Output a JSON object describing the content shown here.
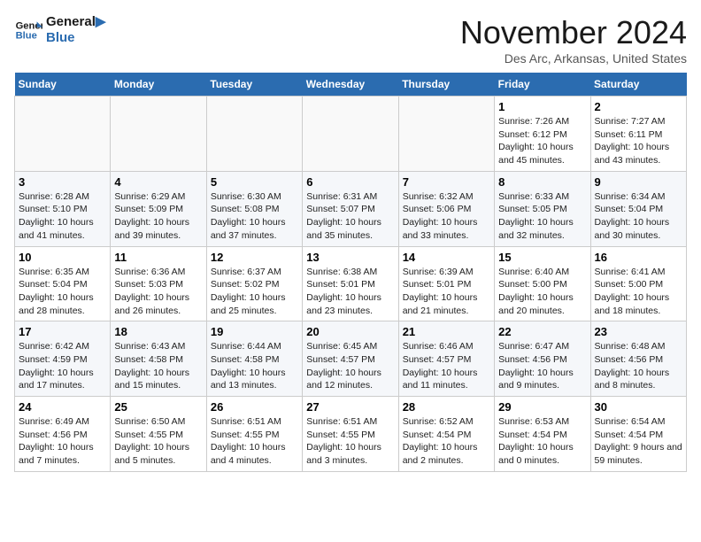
{
  "logo": {
    "line1": "General",
    "line2": "Blue"
  },
  "title": "November 2024",
  "location": "Des Arc, Arkansas, United States",
  "days_of_week": [
    "Sunday",
    "Monday",
    "Tuesday",
    "Wednesday",
    "Thursday",
    "Friday",
    "Saturday"
  ],
  "weeks": [
    [
      {
        "day": "",
        "info": ""
      },
      {
        "day": "",
        "info": ""
      },
      {
        "day": "",
        "info": ""
      },
      {
        "day": "",
        "info": ""
      },
      {
        "day": "",
        "info": ""
      },
      {
        "day": "1",
        "info": "Sunrise: 7:26 AM\nSunset: 6:12 PM\nDaylight: 10 hours and 45 minutes."
      },
      {
        "day": "2",
        "info": "Sunrise: 7:27 AM\nSunset: 6:11 PM\nDaylight: 10 hours and 43 minutes."
      }
    ],
    [
      {
        "day": "3",
        "info": "Sunrise: 6:28 AM\nSunset: 5:10 PM\nDaylight: 10 hours and 41 minutes."
      },
      {
        "day": "4",
        "info": "Sunrise: 6:29 AM\nSunset: 5:09 PM\nDaylight: 10 hours and 39 minutes."
      },
      {
        "day": "5",
        "info": "Sunrise: 6:30 AM\nSunset: 5:08 PM\nDaylight: 10 hours and 37 minutes."
      },
      {
        "day": "6",
        "info": "Sunrise: 6:31 AM\nSunset: 5:07 PM\nDaylight: 10 hours and 35 minutes."
      },
      {
        "day": "7",
        "info": "Sunrise: 6:32 AM\nSunset: 5:06 PM\nDaylight: 10 hours and 33 minutes."
      },
      {
        "day": "8",
        "info": "Sunrise: 6:33 AM\nSunset: 5:05 PM\nDaylight: 10 hours and 32 minutes."
      },
      {
        "day": "9",
        "info": "Sunrise: 6:34 AM\nSunset: 5:04 PM\nDaylight: 10 hours and 30 minutes."
      }
    ],
    [
      {
        "day": "10",
        "info": "Sunrise: 6:35 AM\nSunset: 5:04 PM\nDaylight: 10 hours and 28 minutes."
      },
      {
        "day": "11",
        "info": "Sunrise: 6:36 AM\nSunset: 5:03 PM\nDaylight: 10 hours and 26 minutes."
      },
      {
        "day": "12",
        "info": "Sunrise: 6:37 AM\nSunset: 5:02 PM\nDaylight: 10 hours and 25 minutes."
      },
      {
        "day": "13",
        "info": "Sunrise: 6:38 AM\nSunset: 5:01 PM\nDaylight: 10 hours and 23 minutes."
      },
      {
        "day": "14",
        "info": "Sunrise: 6:39 AM\nSunset: 5:01 PM\nDaylight: 10 hours and 21 minutes."
      },
      {
        "day": "15",
        "info": "Sunrise: 6:40 AM\nSunset: 5:00 PM\nDaylight: 10 hours and 20 minutes."
      },
      {
        "day": "16",
        "info": "Sunrise: 6:41 AM\nSunset: 5:00 PM\nDaylight: 10 hours and 18 minutes."
      }
    ],
    [
      {
        "day": "17",
        "info": "Sunrise: 6:42 AM\nSunset: 4:59 PM\nDaylight: 10 hours and 17 minutes."
      },
      {
        "day": "18",
        "info": "Sunrise: 6:43 AM\nSunset: 4:58 PM\nDaylight: 10 hours and 15 minutes."
      },
      {
        "day": "19",
        "info": "Sunrise: 6:44 AM\nSunset: 4:58 PM\nDaylight: 10 hours and 13 minutes."
      },
      {
        "day": "20",
        "info": "Sunrise: 6:45 AM\nSunset: 4:57 PM\nDaylight: 10 hours and 12 minutes."
      },
      {
        "day": "21",
        "info": "Sunrise: 6:46 AM\nSunset: 4:57 PM\nDaylight: 10 hours and 11 minutes."
      },
      {
        "day": "22",
        "info": "Sunrise: 6:47 AM\nSunset: 4:56 PM\nDaylight: 10 hours and 9 minutes."
      },
      {
        "day": "23",
        "info": "Sunrise: 6:48 AM\nSunset: 4:56 PM\nDaylight: 10 hours and 8 minutes."
      }
    ],
    [
      {
        "day": "24",
        "info": "Sunrise: 6:49 AM\nSunset: 4:56 PM\nDaylight: 10 hours and 7 minutes."
      },
      {
        "day": "25",
        "info": "Sunrise: 6:50 AM\nSunset: 4:55 PM\nDaylight: 10 hours and 5 minutes."
      },
      {
        "day": "26",
        "info": "Sunrise: 6:51 AM\nSunset: 4:55 PM\nDaylight: 10 hours and 4 minutes."
      },
      {
        "day": "27",
        "info": "Sunrise: 6:51 AM\nSunset: 4:55 PM\nDaylight: 10 hours and 3 minutes."
      },
      {
        "day": "28",
        "info": "Sunrise: 6:52 AM\nSunset: 4:54 PM\nDaylight: 10 hours and 2 minutes."
      },
      {
        "day": "29",
        "info": "Sunrise: 6:53 AM\nSunset: 4:54 PM\nDaylight: 10 hours and 0 minutes."
      },
      {
        "day": "30",
        "info": "Sunrise: 6:54 AM\nSunset: 4:54 PM\nDaylight: 9 hours and 59 minutes."
      }
    ]
  ]
}
